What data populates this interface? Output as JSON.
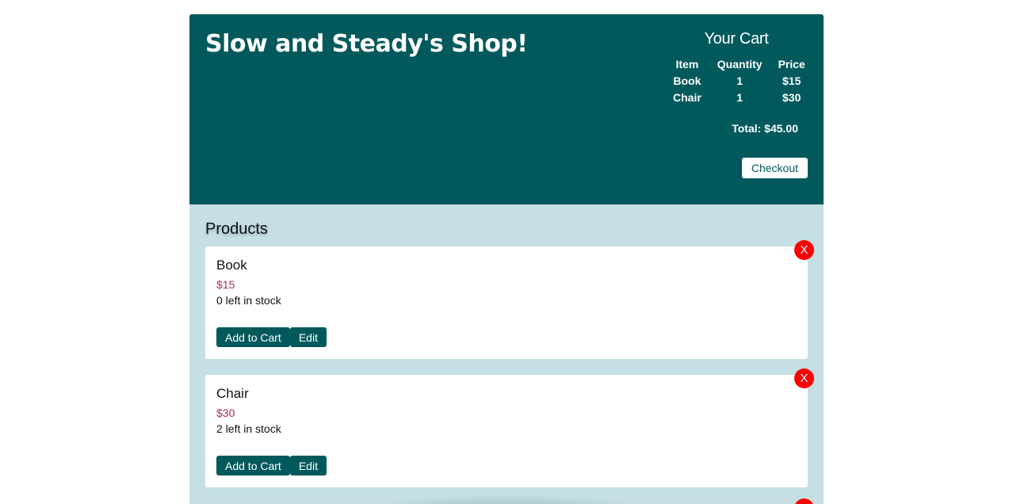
{
  "header": {
    "shop_title": "Slow and Steady's Shop!"
  },
  "cart": {
    "title": "Your Cart",
    "columns": [
      "Item",
      "Quantity",
      "Price"
    ],
    "rows": [
      {
        "item": "Book",
        "quantity": "1",
        "price": "$15"
      },
      {
        "item": "Chair",
        "quantity": "1",
        "price": "$30"
      }
    ],
    "total": "Total: $45.00",
    "checkout_label": "Checkout"
  },
  "products": {
    "heading": "Products",
    "items": [
      {
        "name": "Book",
        "price": "$15",
        "stock": "0 left in stock",
        "add_label": "Add to Cart",
        "edit_label": "Edit",
        "delete_label": "X"
      },
      {
        "name": "Chair",
        "price": "$30",
        "stock": "2 left in stock",
        "add_label": "Add to Cart",
        "edit_label": "Edit",
        "delete_label": "X"
      }
    ]
  },
  "colors": {
    "header_bg": "#02595b",
    "main_bg": "#c5dfe4",
    "price_text": "#a6314f",
    "delete_button": "#ff0000"
  }
}
